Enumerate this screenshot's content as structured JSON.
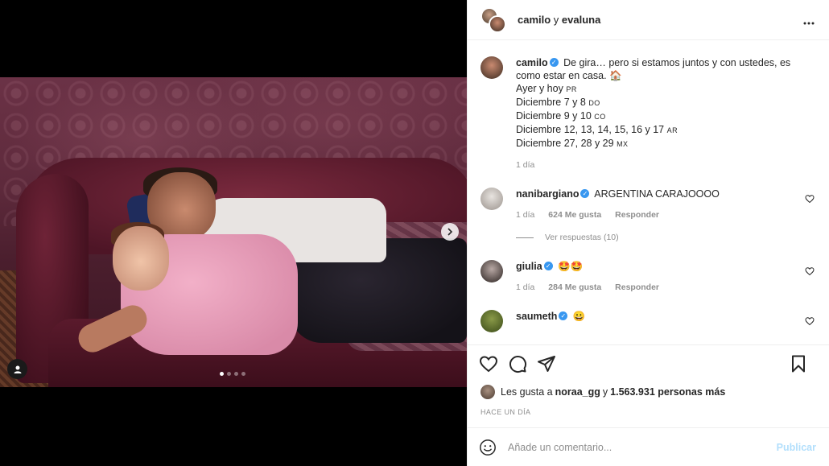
{
  "post": {
    "header_user1": "camilo",
    "header_connector": " y ",
    "header_user2": "evaluna",
    "more_icon": "more-horizontal-icon"
  },
  "caption": {
    "username": "camilo",
    "line1": " De gira… pero si estamos juntos y con ustedes, es como estar en casa. 🏠",
    "line2_main": "Ayer y hoy ",
    "line2_tag": "PR",
    "line3_main": "Diciembre 7 y 8 ",
    "line3_tag": "DO",
    "line4_main": "Diciembre 9 y 10 ",
    "line4_tag": "CO",
    "line5_main": "Diciembre 12, 13, 14, 15, 16 y 17 ",
    "line5_tag": "AR",
    "line6_main": "Diciembre 27, 28 y 29 ",
    "line6_tag": "MX",
    "time": "1 día"
  },
  "comments": [
    {
      "username": "nanibargiano",
      "text": " ARGENTINA CARAJOOOO",
      "time": "1 día",
      "likes": "624 Me gusta",
      "reply": "Responder",
      "view_replies": "Ver respuestas (10)"
    },
    {
      "username": "giulia",
      "text": " 🤩🤩",
      "time": "1 día",
      "likes": "284 Me gusta",
      "reply": "Responder"
    },
    {
      "username": "saumeth",
      "text": " 😀"
    }
  ],
  "likes_prefix": "Les gusta a ",
  "likes_user": "noraa_gg",
  "likes_mid": " y ",
  "likes_count": "1.563.931 personas más",
  "posted_ago": "HACE UN DÍA",
  "comment_input": {
    "placeholder": "Añade un comentario..."
  },
  "publish_label": "Publicar",
  "carousel": {
    "total_slides": 4,
    "active_index": 0
  },
  "colors": {
    "accent": "#3897f0",
    "publish_disabled": "#b2dffc",
    "muted": "#8e8e8e"
  }
}
